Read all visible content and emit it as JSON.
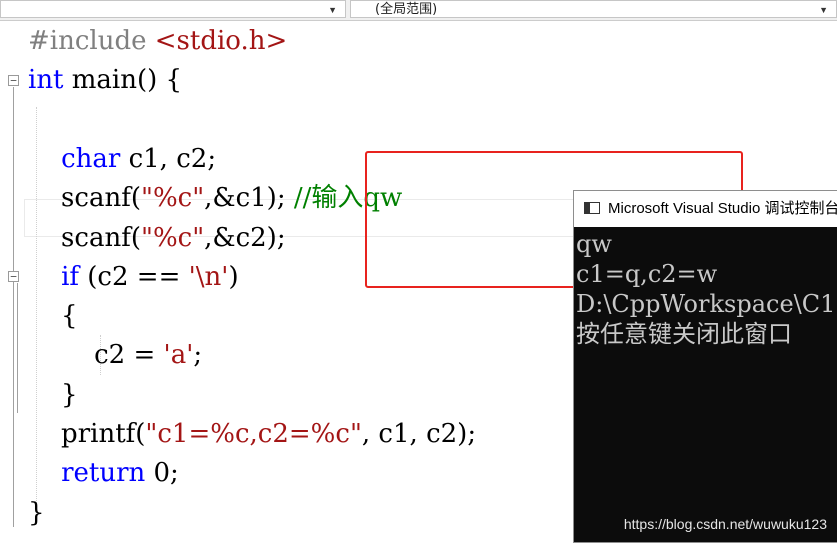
{
  "navbar": {
    "left_dropdown": "",
    "right_dropdown": "(全局范围)"
  },
  "code": [
    [
      {
        "t": "pp",
        "v": "#include "
      },
      {
        "t": "str",
        "v": "<stdio.h>"
      }
    ],
    [
      {
        "t": "kw",
        "v": "int"
      },
      {
        "t": "plain",
        "v": " main() {"
      }
    ],
    [],
    [
      {
        "t": "plain",
        "v": "    "
      },
      {
        "t": "kw",
        "v": "char"
      },
      {
        "t": "plain",
        "v": " c1, c2;"
      }
    ],
    [
      {
        "t": "plain",
        "v": "    scanf("
      },
      {
        "t": "str",
        "v": "\"%c\""
      },
      {
        "t": "plain",
        "v": ",&c1); "
      },
      {
        "t": "cm",
        "v": "//输入qw"
      }
    ],
    [
      {
        "t": "plain",
        "v": "    scanf("
      },
      {
        "t": "str",
        "v": "\"%c\""
      },
      {
        "t": "plain",
        "v": ",&c2);"
      }
    ],
    [
      {
        "t": "plain",
        "v": "    "
      },
      {
        "t": "kw",
        "v": "if"
      },
      {
        "t": "plain",
        "v": " (c2 == "
      },
      {
        "t": "str",
        "v": "'\\n'"
      },
      {
        "t": "plain",
        "v": ")"
      }
    ],
    [
      {
        "t": "plain",
        "v": "    {"
      }
    ],
    [
      {
        "t": "plain",
        "v": "        c2 = "
      },
      {
        "t": "str",
        "v": "'a'"
      },
      {
        "t": "plain",
        "v": ";"
      }
    ],
    [
      {
        "t": "plain",
        "v": "    }"
      }
    ],
    [
      {
        "t": "plain",
        "v": "    printf("
      },
      {
        "t": "str",
        "v": "\"c1=%c,c2=%c\""
      },
      {
        "t": "plain",
        "v": ", c1, c2);"
      }
    ],
    [
      {
        "t": "plain",
        "v": "    "
      },
      {
        "t": "kw",
        "v": "return"
      },
      {
        "t": "plain",
        "v": " 0;"
      }
    ],
    [
      {
        "t": "plain",
        "v": "}"
      }
    ]
  ],
  "console": {
    "title": "Microsoft Visual Studio 调试控制台",
    "lines": [
      "qw",
      "c1=q,c2=w",
      "D:\\CppWorkspace\\C1",
      "按任意键关闭此窗口"
    ]
  },
  "watermark": "https://blog.csdn.net/wuwuku123",
  "colors": {
    "keyword": "#0000ff",
    "preprocessor": "#808080",
    "string": "#a31515",
    "comment": "#008000",
    "annotation_box": "#e8231e",
    "console_bg": "#0c0c0c"
  }
}
